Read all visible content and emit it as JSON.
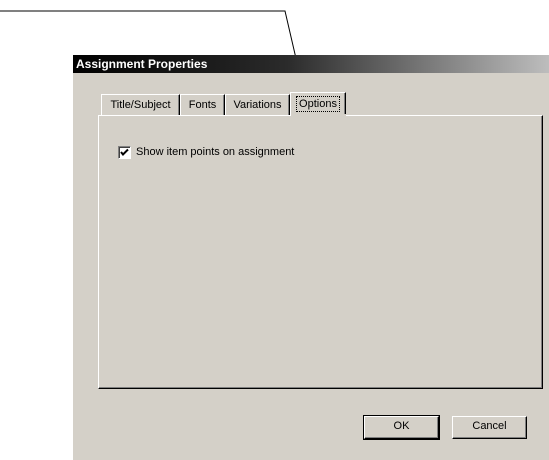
{
  "dialog": {
    "title": "Assignment Properties",
    "tabs": [
      {
        "label": "Title/Subject",
        "active": false
      },
      {
        "label": "Fonts",
        "active": false
      },
      {
        "label": "Variations",
        "active": false
      },
      {
        "label": "Options",
        "active": true
      }
    ],
    "options": {
      "show_points_label": "Show item points on assignment",
      "show_points_checked": true
    },
    "buttons": {
      "ok": "OK",
      "cancel": "Cancel"
    },
    "colors": {
      "face": "#d4d0c8",
      "titlebar_start": "#000000",
      "titlebar_end": "#bdbdbd"
    }
  }
}
